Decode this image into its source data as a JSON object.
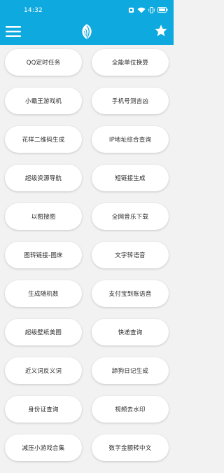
{
  "status_bar": {
    "time": "14:32",
    "icons": [
      "alarm-icon",
      "wifi-icon",
      "vibrate-icon",
      "battery-icon"
    ]
  },
  "toolbar": {
    "menu_icon": "hamburger-menu-icon",
    "logo_icon": "leaf-logo-icon",
    "star_icon": "star-icon",
    "color": "#0ea9df"
  },
  "tools": [
    [
      "QQ定时任务",
      "全能单位换算"
    ],
    [
      "小霸王游戏机",
      "手机号测吉凶"
    ],
    [
      "花样二维码生成",
      "IP地址综合查询"
    ],
    [
      "超级资源导航",
      "短链接生成"
    ],
    [
      "以图搜图",
      "全网音乐下载"
    ],
    [
      "图转链接-图床",
      "文字转语音"
    ],
    [
      "生成随机数",
      "支付宝到账语音"
    ],
    [
      "超级壁纸美图",
      "快递查询"
    ],
    [
      "近义词反义词",
      "舔狗日记生成"
    ],
    [
      "身份证查询",
      "视频去水印"
    ],
    [
      "减压小游戏合集",
      "数字金额转中文"
    ]
  ]
}
